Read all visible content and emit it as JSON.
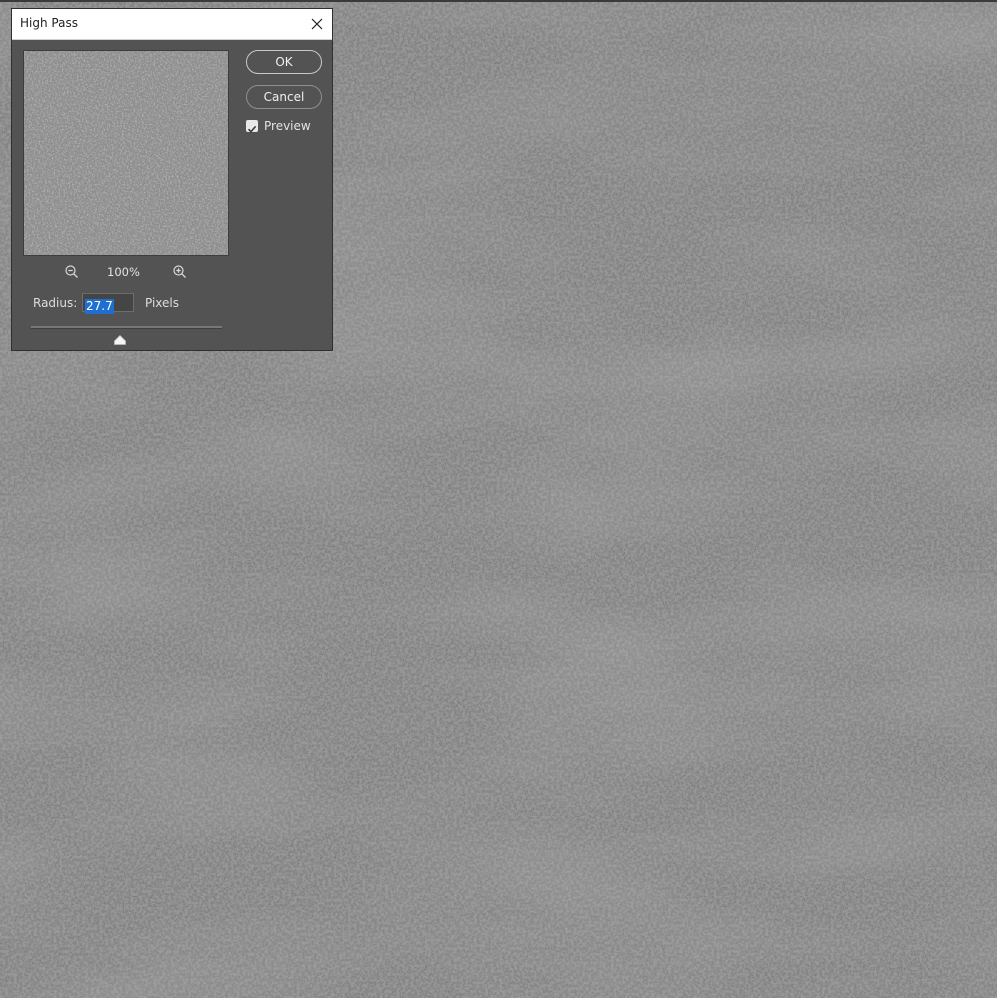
{
  "dialog": {
    "title": "High Pass",
    "close_icon": "close-icon",
    "zoom": {
      "level": "100%",
      "zoom_out_icon": "zoom-out-icon",
      "zoom_in_icon": "zoom-in-icon"
    },
    "radius": {
      "label": "Radius:",
      "value": "27.7",
      "units": "Pixels"
    },
    "buttons": {
      "ok": "OK",
      "cancel": "Cancel"
    },
    "preview": {
      "label": "Preview",
      "checked": true
    }
  },
  "colors": {
    "canvas_gray": "#7d7d7d",
    "dialog_bg": "#535353",
    "selection_blue": "#1f6fd1"
  }
}
